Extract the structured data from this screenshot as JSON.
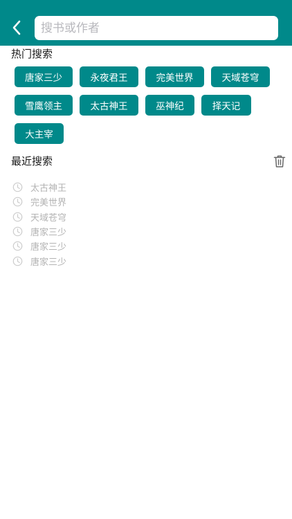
{
  "header": {
    "search_placeholder": "搜书或作者",
    "accent_color": "#00898a",
    "back_icon": "chevron-left-icon"
  },
  "hot_search": {
    "title": "热门搜索",
    "tags": [
      "唐家三少",
      "永夜君王",
      "完美世界",
      "天域苍穹",
      "雪鹰领主",
      "太古神王",
      "巫神纪",
      "择天记",
      "大主宰"
    ]
  },
  "recent_search": {
    "title": "最近搜索",
    "trash_icon": "trash-icon",
    "history_icon": "clock-icon",
    "items": [
      "太古神王",
      "完美世界",
      "天域苍穹",
      "唐家三少",
      "唐家三少",
      "唐家三少"
    ]
  }
}
